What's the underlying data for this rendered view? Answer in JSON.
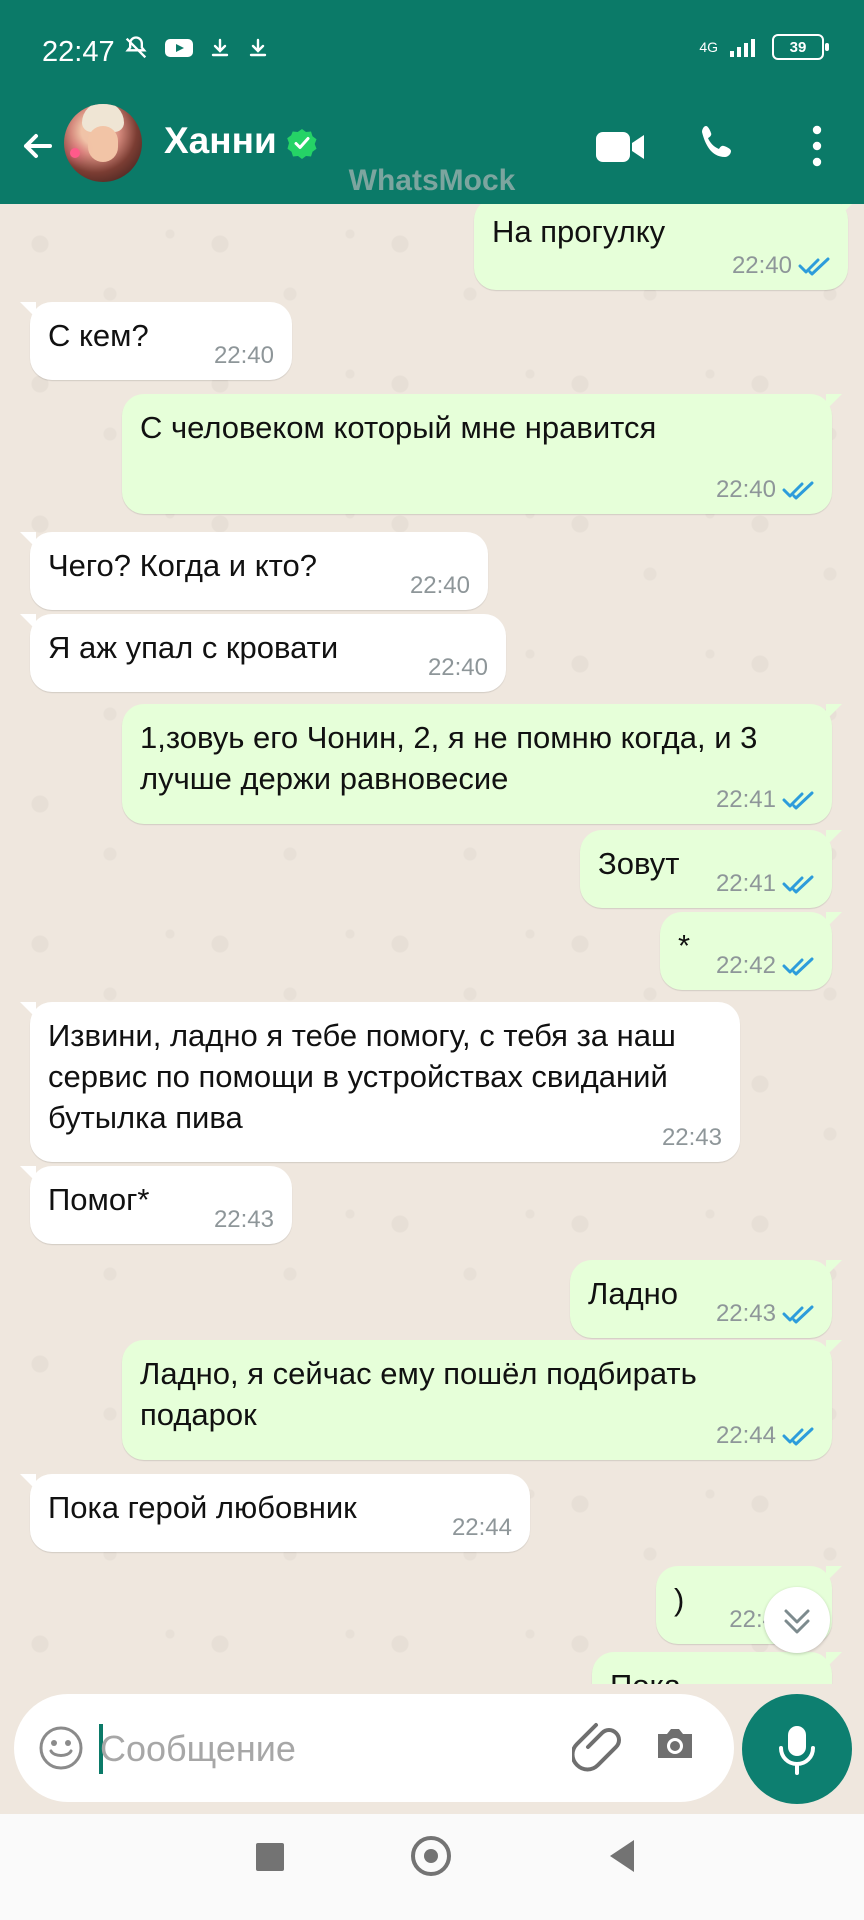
{
  "status_bar": {
    "time": "22:47",
    "network": "4G",
    "battery": "39"
  },
  "header": {
    "contact_name": "Ханни",
    "watermark": "WhatsMock",
    "avatar_icon": "contact-avatar",
    "verified_icon": "verified-icon",
    "accent_color": "#0b7a68"
  },
  "chat": {
    "messages": [
      {
        "direction": "outgoing",
        "text": "На прогулку",
        "time": "22:40",
        "status": "read"
      },
      {
        "direction": "incoming",
        "text": "С кем?",
        "time": "22:40"
      },
      {
        "direction": "outgoing",
        "text": "С человеком который мне нравится",
        "time": "22:40",
        "status": "read"
      },
      {
        "direction": "incoming",
        "text": "Чего? Когда и кто?",
        "time": "22:40"
      },
      {
        "direction": "incoming",
        "text": "Я аж упал с кровати",
        "time": "22:40"
      },
      {
        "direction": "outgoing",
        "text": "1,зовуь его Чонин, 2, я не помню когда, и 3 лучше держи равновесие",
        "time": "22:41",
        "status": "read"
      },
      {
        "direction": "outgoing",
        "text": "Зовут",
        "time": "22:41",
        "status": "read"
      },
      {
        "direction": "outgoing",
        "text": "*",
        "time": "22:42",
        "status": "read"
      },
      {
        "direction": "incoming",
        "text": "Извини, ладно я тебе помогу, с тебя за наш сервис по помощи в устройствах свиданий бутылка пива",
        "time": "22:43"
      },
      {
        "direction": "incoming",
        "text": "Помог*",
        "time": "22:43"
      },
      {
        "direction": "outgoing",
        "text": "Ладно",
        "time": "22:43",
        "status": "read"
      },
      {
        "direction": "outgoing",
        "text": "Ладно, я сейчас ему пошёл подбирать подарок",
        "time": "22:44",
        "status": "read"
      },
      {
        "direction": "incoming",
        "text": "Пока герой любовник",
        "time": "22:44"
      },
      {
        "direction": "outgoing",
        "text": ")",
        "time": "22:4",
        "status": "read"
      },
      {
        "direction": "outgoing",
        "text": "Пока",
        "time": "",
        "status": "read"
      }
    ],
    "colors": {
      "incoming_bubble": "#ffffff",
      "outgoing_bubble": "#e6ffd9",
      "read_ticks": "#2d9cdb"
    }
  },
  "composer": {
    "placeholder": "Сообщение",
    "value": ""
  }
}
